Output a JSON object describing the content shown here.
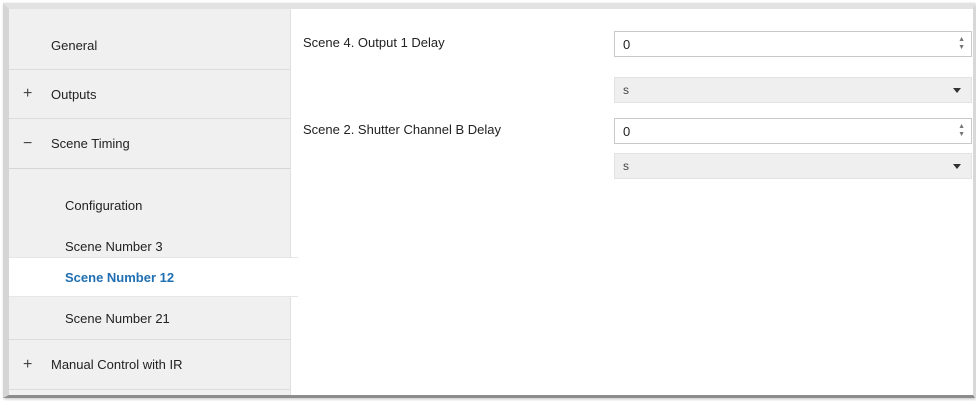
{
  "sidebar": {
    "general": "General",
    "outputs": {
      "sign": "+",
      "label": "Outputs"
    },
    "scene_timing": {
      "sign": "−",
      "label": "Scene Timing"
    },
    "sub_items": [
      "Configuration",
      "Scene Number 3",
      "Scene Number 12",
      "Scene Number 21"
    ],
    "active_item": "Scene Number 12",
    "manual_control": {
      "sign": "+",
      "label": "Manual Control with IR"
    }
  },
  "main": {
    "fields": [
      {
        "label": "Scene 4. Output 1 Delay",
        "value": "0",
        "unit": "s"
      },
      {
        "label": "Scene 2. Shutter Channel B Delay",
        "value": "0",
        "unit": "s"
      }
    ]
  },
  "colors": {
    "active_text": "#1f6fb2",
    "sidebar_bg": "#f0f0f0"
  }
}
